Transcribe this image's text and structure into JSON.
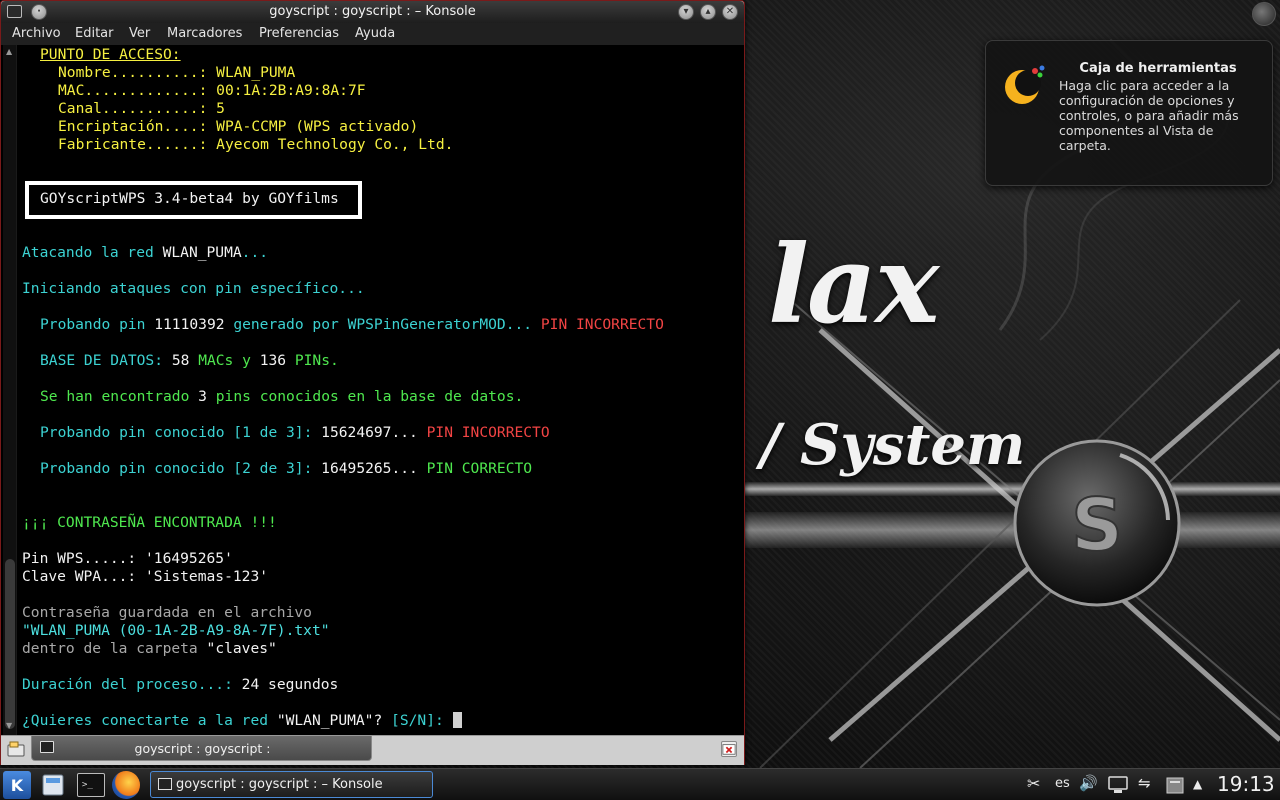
{
  "window": {
    "title": "goyscript : goyscript : – Konsole",
    "menu": [
      "Archivo",
      "Editar",
      "Ver",
      "Marcadores",
      "Preferencias",
      "Ayuda"
    ],
    "tab_label": "goyscript : goyscript :"
  },
  "terminal": {
    "ap_header": "PUNTO DE ACCESO:",
    "name_label": "Nombre..........:",
    "name_value": "WLAN_PUMA",
    "mac_label": "MAC.............:",
    "mac_value": "00:1A:2B:A9:8A:7F",
    "channel_label": "Canal...........:",
    "channel_value": "5",
    "enc_label": "Encriptación....:",
    "enc_value": "WPA-CCMP (WPS activado)",
    "vendor_label": "Fabricante......:",
    "vendor_value": "Ayecom Technology Co., Ltd.",
    "banner": "GOYscriptWPS 3.4-beta4 by GOYfilms",
    "attacking_prefix": "Atacando la red",
    "attacking_net": "WLAN_PUMA",
    "attacking_suffix": "...",
    "starting": "Iniciando ataques con pin específico...",
    "try1_a": "Probando pin",
    "try1_pin": "11110392",
    "try1_b": "generado por",
    "try1_gen": "WPSPinGeneratorMOD...",
    "try1_result": "PIN INCORRECTO",
    "db_label": "BASE DE DATOS:",
    "db_macs_n": "58",
    "db_macs": "MACs y",
    "db_pins_n": "136",
    "db_pins": "PINs.",
    "found_a": "Se han encontrado",
    "found_n": "3",
    "found_b": "pins conocidos en la base de datos.",
    "known1_a": "Probando pin conocido [1 de 3]:",
    "known1_pin": "15624697...",
    "known1_result": "PIN INCORRECTO",
    "known2_a": "Probando pin conocido [2 de 3]:",
    "known2_pin": "16495265...",
    "known2_result": "PIN CORRECTO",
    "found_pw": "¡¡¡ CONTRASEÑA ENCONTRADA !!!",
    "pin_wps": "Pin WPS.....: '16495265'",
    "wpa_key": "Clave WPA...: 'Sistemas-123'",
    "saved1": "Contraseña guardada en el archivo",
    "saved_file": "\"WLAN_PUMA (00-1A-2B-A9-8A-7F).txt\"",
    "saved2": "dentro de la carpeta",
    "saved_folder": "\"claves\"",
    "duration_label": "Duración del proceso...:",
    "duration_value": "24 segundos",
    "prompt_a": "¿Quieres conectarte a la red",
    "prompt_net": "\"WLAN_PUMA\"?",
    "prompt_b": "[S/N]:"
  },
  "tooltip": {
    "title": "Caja de herramientas",
    "body": "Haga clic para acceder a la configuración de opciones y controles, o para añadir más componentes al Vista de carpeta."
  },
  "taskbar": {
    "task_label": "goyscript : goyscript : – Konsole",
    "keyboard_layout": "es",
    "clock": "19:13"
  },
  "colors": {
    "window_border": "#7a1a1a",
    "terminal_bg": "#000000",
    "yellow": "#f6f041",
    "cyan": "#3cd2d2",
    "green": "#4fe84f",
    "red": "#f24444"
  }
}
